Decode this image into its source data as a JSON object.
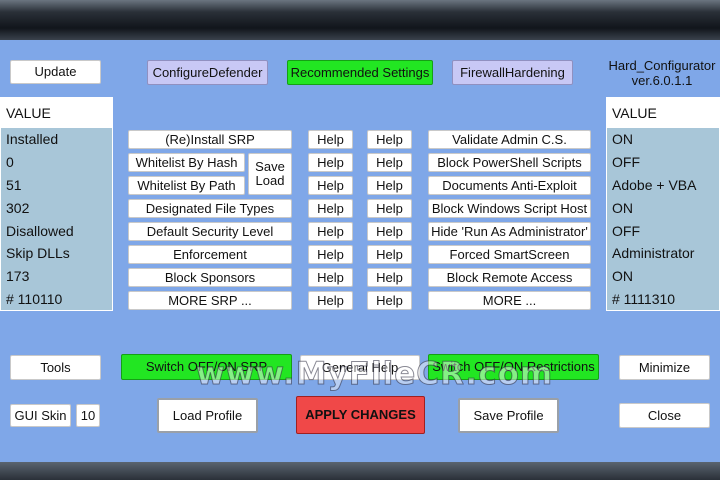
{
  "top_buttons": {
    "update": "Update",
    "configure_defender": "ConfigureDefender",
    "recommended_settings": "Recommended Settings",
    "firewall_hardening": "FirewallHardening"
  },
  "version": {
    "name": "Hard_Configurator",
    "number": "ver.6.0.1.1"
  },
  "left_list": {
    "header": "VALUE",
    "items": [
      "Installed",
      "0",
      "51",
      "302",
      "Disallowed",
      "Skip DLLs",
      "173",
      "# 110110"
    ]
  },
  "right_list": {
    "header": "VALUE",
    "items": [
      "ON",
      "OFF",
      "Adobe + VBA",
      "ON",
      "OFF",
      "Administrator",
      "ON",
      "# 1111310"
    ]
  },
  "srp_buttons": {
    "reinstall": "(Re)Install SRP",
    "whitelist_hash": "Whitelist By Hash",
    "whitelist_path": "Whitelist By Path",
    "save_load_1": "Save",
    "save_load_2": "Load",
    "file_types": "Designated File Types",
    "security_level": "Default Security Level",
    "enforcement": "Enforcement",
    "block_sponsors": "Block Sponsors",
    "more_srp": "MORE SRP ..."
  },
  "help_label": "Help",
  "restriction_buttons": {
    "validate_admin": "Validate Admin C.S.",
    "block_powershell": "Block PowerShell Scripts",
    "documents_anti_exploit": "Documents Anti-Exploit",
    "block_wsh": "Block Windows Script Host",
    "hide_run_as_admin": "Hide 'Run As Administrator'",
    "forced_smartscreen": "Forced SmartScreen",
    "block_remote_access": "Block Remote Access",
    "more": "MORE ..."
  },
  "bottom": {
    "tools": "Tools",
    "switch_srp": "Switch OFF/ON SRP",
    "general_help": "General Help",
    "switch_restrictions": "Switch OFF/ON Restrictions",
    "minimize": "Minimize",
    "gui_skin": "GUI Skin",
    "gui_skin_value": "10",
    "load_profile": "Load Profile",
    "apply_changes": "APPLY CHANGES",
    "save_profile": "Save Profile",
    "close": "Close"
  },
  "watermark": "www.MyFileCR.com",
  "colors": {
    "panel": "#7fa7e8",
    "green": "#22e622",
    "red": "#f04848",
    "lavender": "#c8c8f5",
    "list_bg": "#a8c6d8"
  }
}
